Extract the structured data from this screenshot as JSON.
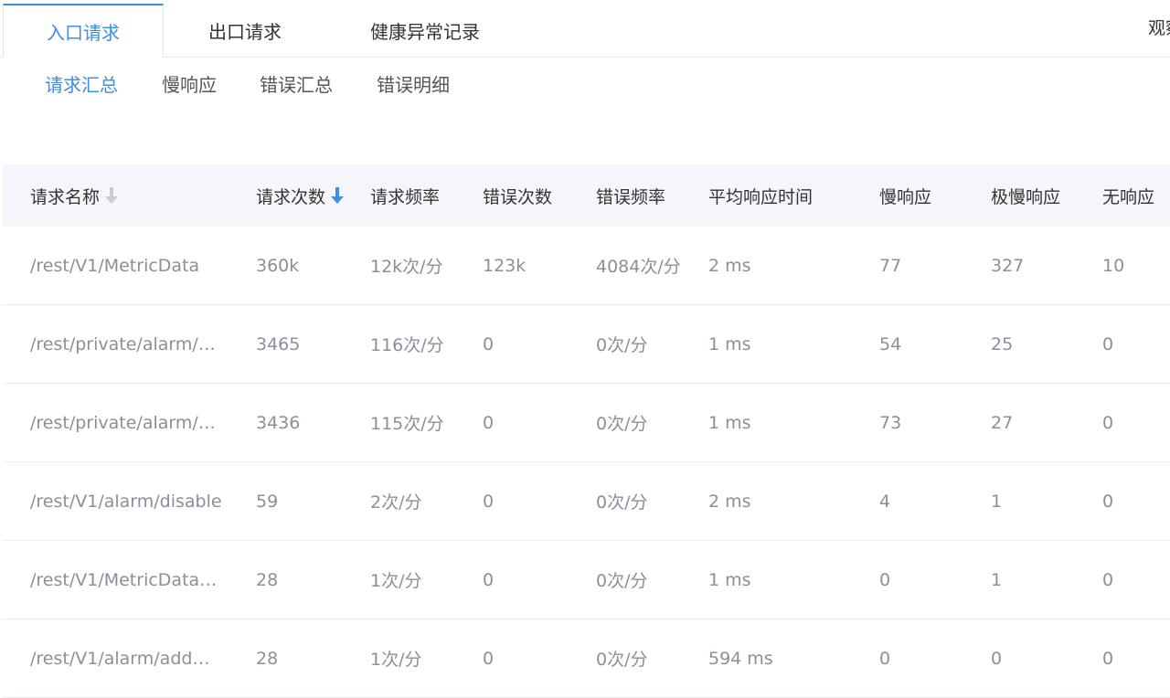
{
  "top_tabs": [
    {
      "label": "入口请求",
      "active": true
    },
    {
      "label": "出口请求",
      "active": false
    },
    {
      "label": "健康异常记录",
      "active": false
    }
  ],
  "corner_label": "观察",
  "sub_tabs": [
    {
      "label": "请求汇总",
      "active": true
    },
    {
      "label": "慢响应",
      "active": false
    },
    {
      "label": "错误汇总",
      "active": false
    },
    {
      "label": "错误明细",
      "active": false
    }
  ],
  "colors": {
    "accent": "#3d8fe0",
    "header_bg": "#f4f6fb",
    "muted_text": "#8a8f99"
  },
  "table": {
    "columns": [
      "请求名称",
      "请求次数",
      "请求频率",
      "错误次数",
      "错误频率",
      "平均响应时间",
      "慢响应",
      "极慢响应",
      "无响应"
    ],
    "sort": {
      "name_col": "inactive-arrow-down-icon",
      "count_col": "active-arrow-down-icon"
    },
    "rows": [
      [
        "/rest/V1/MetricData",
        "360k",
        "12k次/分",
        "123k",
        "4084次/分",
        "2 ms",
        "77",
        "327",
        "10"
      ],
      [
        "/rest/private/alarm/…",
        "3465",
        "116次/分",
        "0",
        "0次/分",
        "1 ms",
        "54",
        "25",
        "0"
      ],
      [
        "/rest/private/alarm/…",
        "3436",
        "115次/分",
        "0",
        "0次/分",
        "1 ms",
        "73",
        "27",
        "0"
      ],
      [
        "/rest/V1/alarm/disable",
        "59",
        "2次/分",
        "0",
        "0次/分",
        "2 ms",
        "4",
        "1",
        "0"
      ],
      [
        "/rest/V1/MetricData…",
        "28",
        "1次/分",
        "0",
        "0次/分",
        "1 ms",
        "0",
        "1",
        "0"
      ],
      [
        "/rest/V1/alarm/add…",
        "28",
        "1次/分",
        "0",
        "0次/分",
        "594 ms",
        "0",
        "0",
        "0"
      ]
    ]
  }
}
